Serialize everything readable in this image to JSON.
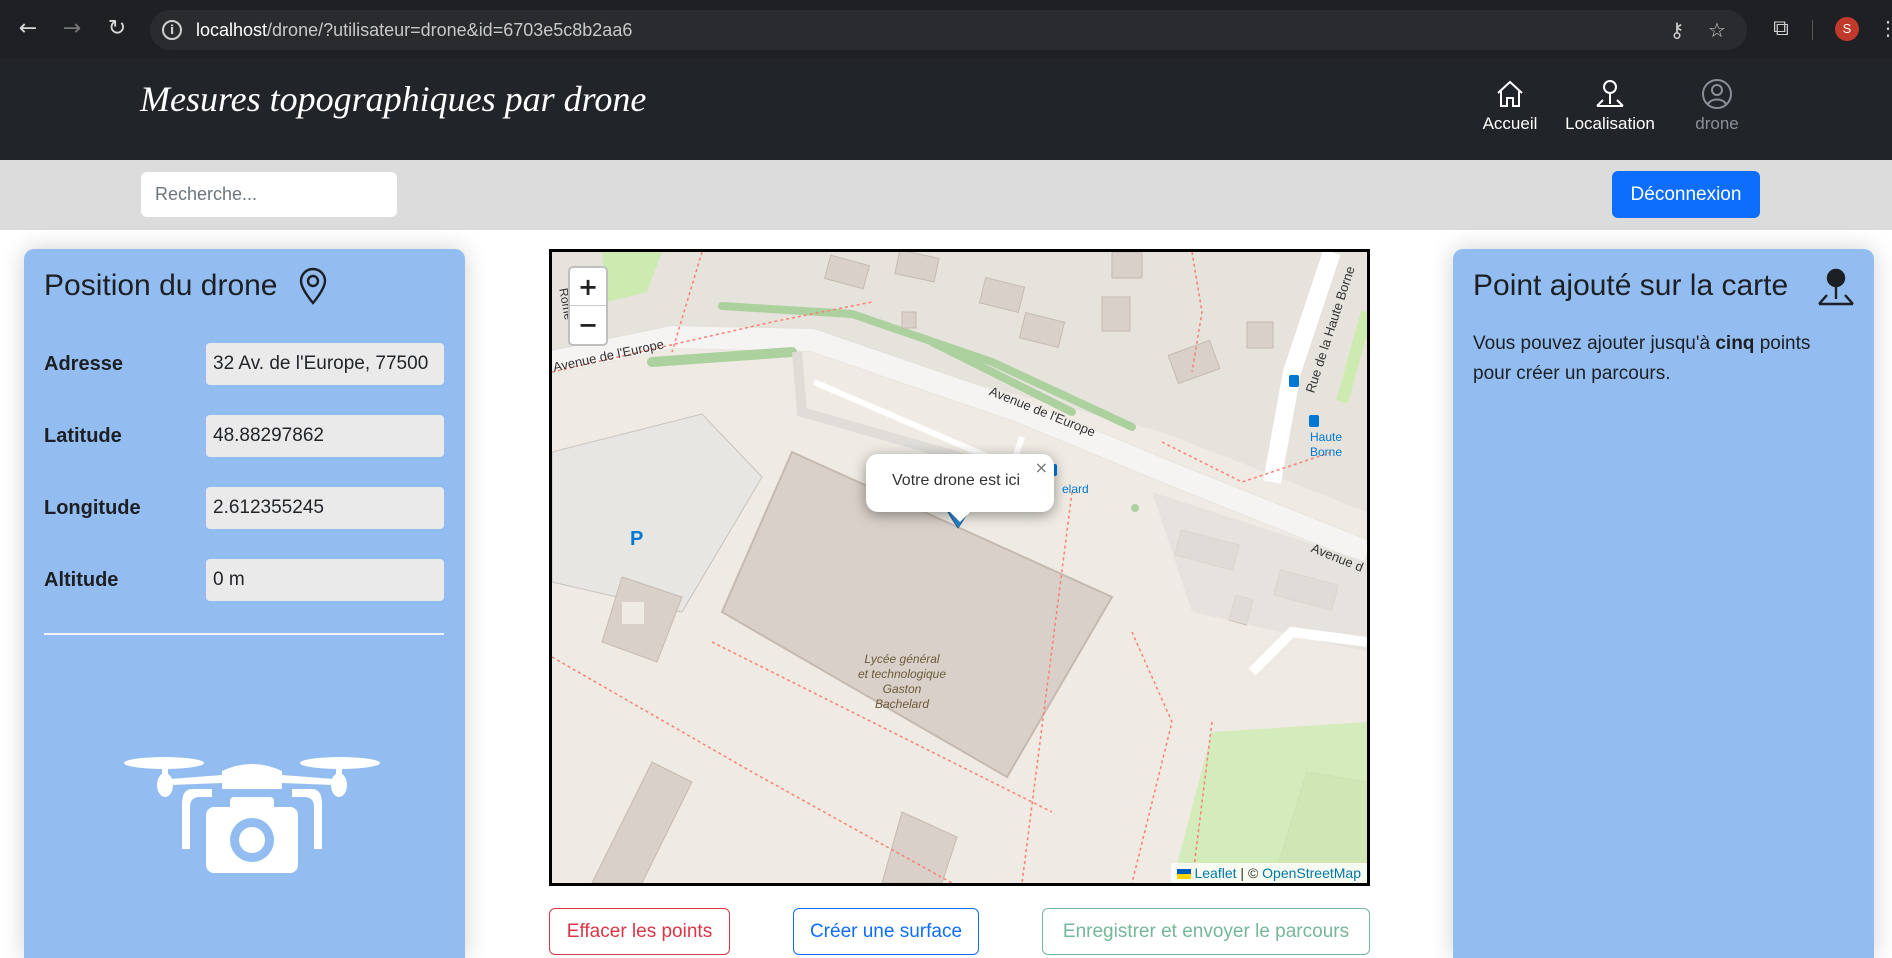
{
  "browser": {
    "url_host": "localhost",
    "url_path": "/drone/?utilisateur=drone&id=6703e5c8b2aa6",
    "profile_initial": "S"
  },
  "app": {
    "title": "Mesures topographiques par drone",
    "nav": [
      {
        "label": "Accueil",
        "icon": "home-icon"
      },
      {
        "label": "Localisation",
        "icon": "location-person-icon"
      },
      {
        "label": "drone",
        "icon": "user-circle-icon"
      }
    ]
  },
  "toolbar": {
    "search_placeholder": "Recherche...",
    "logout_label": "Déconnexion"
  },
  "drone_panel": {
    "title": "Position du drone",
    "fields": [
      {
        "label": "Adresse",
        "value": "32 Av. de l'Europe, 77500"
      },
      {
        "label": "Latitude",
        "value": "48.88297862"
      },
      {
        "label": "Longitude",
        "value": "2.612355245"
      },
      {
        "label": "Altitude",
        "value": "0 m"
      }
    ]
  },
  "points_panel": {
    "title": "Point ajouté sur la carte",
    "text_before": "Vous pouvez ajouter jusqu'à ",
    "text_bold": "cinq",
    "text_after": " points pour créer un parcours."
  },
  "map": {
    "popup_text": "Votre drone est ici",
    "zoom_in": "+",
    "zoom_out": "−",
    "attribution_leaflet": "Leaflet",
    "attribution_sep": " | © ",
    "attribution_osm": "OpenStreetMap",
    "labels": {
      "street1": "Avenue de l'Europe",
      "street2": "Avenue de l'Europe",
      "street3": "Avenue d",
      "street4": "Rue de la Haute Borne",
      "street5": "Rome",
      "bus1": "Haute",
      "bus2": "Borne",
      "bus3": "elard",
      "school": [
        "Lycée général",
        "et technologique",
        "Gaston",
        "Bachelard"
      ],
      "parking": "P"
    }
  },
  "actions": {
    "clear": "Effacer les points",
    "surface": "Créer une surface",
    "save": "Enregistrer et envoyer le parcours"
  },
  "colors": {
    "panel": "#93bdf0",
    "primary": "#0d6efd",
    "danger": "#dc3545",
    "success": "#75b798",
    "header": "#212529"
  }
}
